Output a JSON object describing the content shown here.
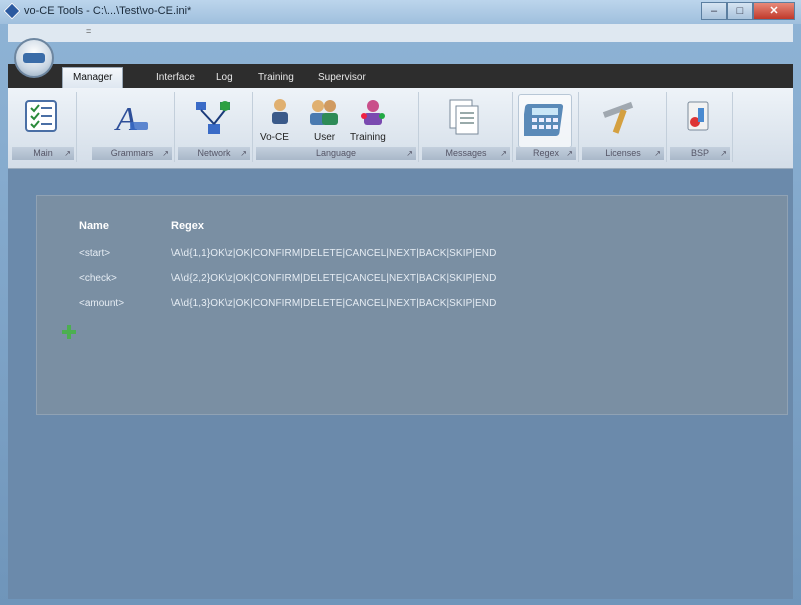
{
  "window": {
    "title": "vo-CE Tools - C:\\...\\Test\\vo-CE.ini*",
    "min_label": "–",
    "max_label": "□",
    "close_label": "✕"
  },
  "qat": {
    "dot": "="
  },
  "tabs": [
    {
      "label": "Manager",
      "active": true
    },
    {
      "label": "Interface",
      "active": false
    },
    {
      "label": "Log",
      "active": false
    },
    {
      "label": "Training",
      "active": false
    },
    {
      "label": "Supervisor",
      "active": false
    }
  ],
  "ribbon": {
    "groups": [
      {
        "label": "Main",
        "icon": "checklist-icon"
      },
      {
        "label": "Grammars",
        "icon": "font-icon"
      },
      {
        "label": "Network",
        "icon": "network-icon"
      },
      {
        "label": "Language",
        "buttons": [
          "Vo-CE",
          "User",
          "Training"
        ]
      },
      {
        "label": "Messages",
        "icon": "documents-icon"
      },
      {
        "label": "Regex",
        "icon": "calculator-icon",
        "selected": true
      },
      {
        "label": "Licenses",
        "icon": "tools-icon"
      },
      {
        "label": "BSP",
        "icon": "bsp-icon"
      }
    ]
  },
  "table": {
    "headers": {
      "name": "Name",
      "regex": "Regex"
    },
    "rows": [
      {
        "name": "<start>",
        "regex": "\\A\\d{1,1}OK\\z|OK|CONFIRM|DELETE|CANCEL|NEXT|BACK|SKIP|END"
      },
      {
        "name": "<check>",
        "regex": "\\A\\d{2,2}OK\\z|OK|CONFIRM|DELETE|CANCEL|NEXT|BACK|SKIP|END"
      },
      {
        "name": "<amount>",
        "regex": "\\A\\d{1,3}OK\\z|OK|CONFIRM|DELETE|CANCEL|NEXT|BACK|SKIP|END"
      }
    ]
  },
  "colors": {
    "background": "#6b8aab",
    "panel": "#7a8fa3",
    "tabstrip": "#2d2d2d",
    "add_icon": "#4caf50"
  }
}
